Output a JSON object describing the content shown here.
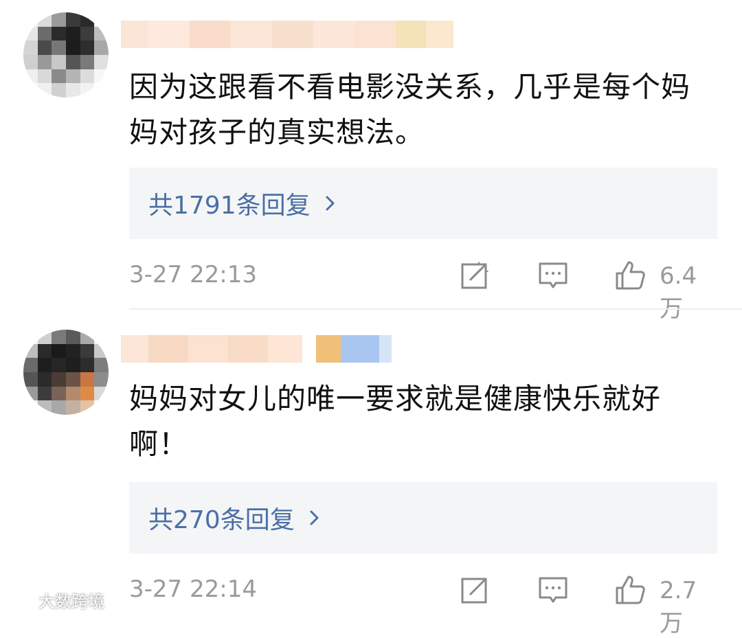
{
  "comments": [
    {
      "text": "因为这跟看不看电影没关系，几乎是每个妈妈对孩子的真实想法。",
      "replies_label": "共1791条回复",
      "time": "3-27 22:13",
      "likes": "6.4万"
    },
    {
      "text": "妈妈对女儿的唯一要求就是健康快乐就好啊！",
      "replies_label": "共270条回复",
      "time": "3-27 22:14",
      "likes": "2.7万"
    }
  ],
  "icons": {
    "share": "share-edit-icon",
    "comment": "comment-bubble-icon",
    "like": "thumbs-up-icon",
    "chevron": "chevron-right-icon"
  },
  "colors": {
    "reply_link": "#4a6fa5",
    "reply_bg": "#f4f5f7",
    "meta_text": "#9a9a9a"
  },
  "watermark": {
    "text": "大数跨境"
  }
}
